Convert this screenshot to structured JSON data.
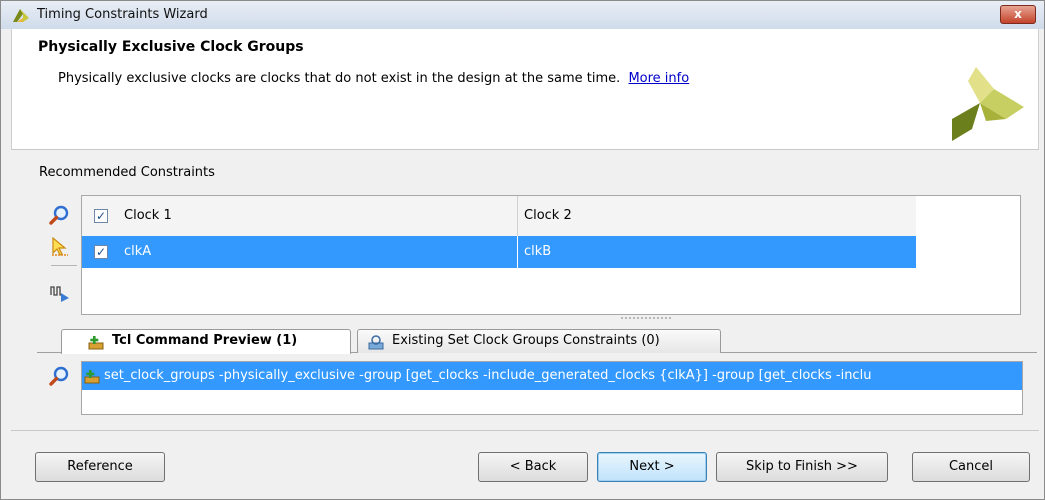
{
  "window": {
    "title": "Timing Constraints Wizard",
    "close_glyph": "x"
  },
  "header": {
    "title": "Physically Exclusive Clock Groups",
    "description": "Physically exclusive clocks are clocks that do not exist in the design at the same time.",
    "more_info": "More info"
  },
  "recommended": {
    "label": "Recommended Constraints",
    "columns": [
      "Clock 1",
      "Clock 2"
    ],
    "rows": [
      {
        "clock1": "clkA",
        "clock2": "clkB",
        "checked": true
      }
    ],
    "header_checked": true,
    "side_icons": [
      "search-icon",
      "select-pointer-icon",
      "waveform-run-icon"
    ]
  },
  "tabs": [
    {
      "label": "Tcl Command Preview (1)",
      "icon": "tcl-add-icon",
      "active": true
    },
    {
      "label": "Existing Set Clock Groups Constraints (0)",
      "icon": "constraints-icon",
      "active": false
    }
  ],
  "command": {
    "text": "set_clock_groups -physically_exclusive -group [get_clocks -include_generated_clocks {clkA}] -group [get_clocks -inclu"
  },
  "buttons": {
    "reference": "Reference",
    "back": "< Back",
    "next": "Next >",
    "skip": "Skip to Finish >>",
    "cancel": "Cancel"
  },
  "colors": {
    "selection": "#3399ff",
    "link": "#0000cc"
  }
}
